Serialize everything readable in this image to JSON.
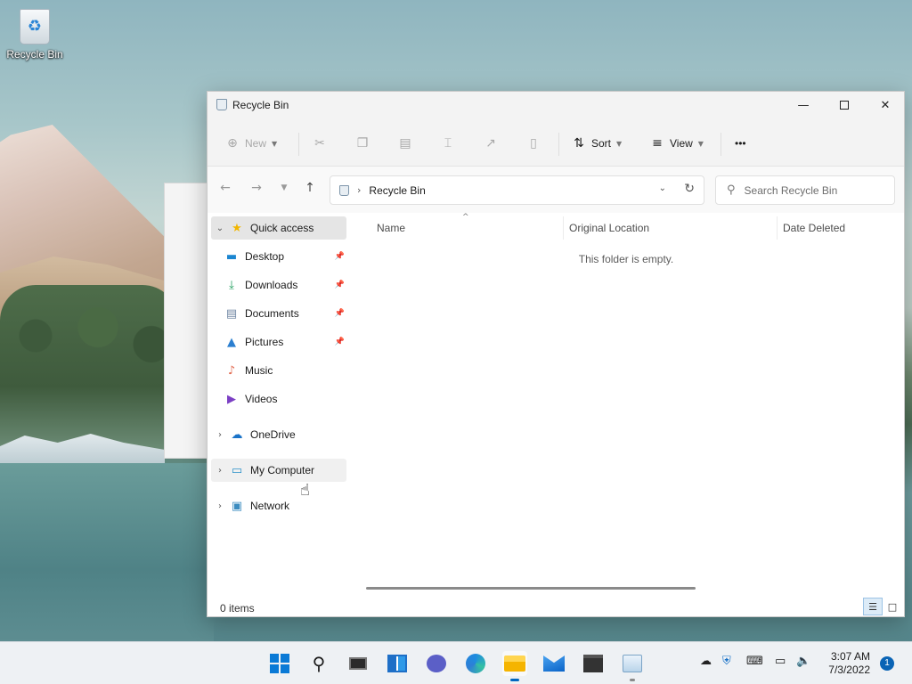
{
  "desktop": {
    "icons": [
      {
        "label": "Recycle Bin",
        "icon": "recycle-bin-icon"
      }
    ]
  },
  "window": {
    "title": "Recycle Bin",
    "controls": {
      "minimize": "minimize-icon",
      "maximize": "maximize-icon",
      "close": "close-icon"
    }
  },
  "toolbar": {
    "new_label": "New",
    "sort_label": "Sort",
    "view_label": "View",
    "more_label": "•••",
    "disabled_actions": [
      "cut-icon",
      "copy-icon",
      "paste-icon",
      "rename-icon",
      "share-icon",
      "delete-icon"
    ]
  },
  "address": {
    "path": "Recycle Bin"
  },
  "search": {
    "placeholder": "Search Recycle Bin"
  },
  "nav": {
    "quick_access": "Quick access",
    "pinned": [
      {
        "label": "Desktop",
        "icon": "desktop-icon",
        "pinned": true
      },
      {
        "label": "Downloads",
        "icon": "download-icon",
        "pinned": true
      },
      {
        "label": "Documents",
        "icon": "document-icon",
        "pinned": true
      },
      {
        "label": "Pictures",
        "icon": "pictures-icon",
        "pinned": true
      },
      {
        "label": "Music",
        "icon": "music-icon",
        "pinned": false
      },
      {
        "label": "Videos",
        "icon": "videos-icon",
        "pinned": false
      }
    ],
    "onedrive": "OneDrive",
    "my_computer": "My Computer",
    "network": "Network"
  },
  "content": {
    "columns": [
      "Name",
      "Original Location",
      "Date Deleted"
    ],
    "empty_message": "This folder is empty."
  },
  "status": {
    "item_count": "0 items"
  },
  "taskbar": {
    "apps": [
      "start-icon",
      "search-icon",
      "task-view-icon",
      "widgets-icon",
      "chat-icon",
      "edge-icon",
      "file-explorer-icon",
      "mail-icon",
      "store-icon",
      "control-panel-icon"
    ],
    "time": "3:07 AM",
    "date": "7/3/2022",
    "notification_count": "1"
  },
  "colors": {
    "accent": "#0067c0",
    "window_bg": "#ffffff",
    "toolbar_bg": "#f3f3f3",
    "taskbar_bg": "#eef1f4"
  }
}
